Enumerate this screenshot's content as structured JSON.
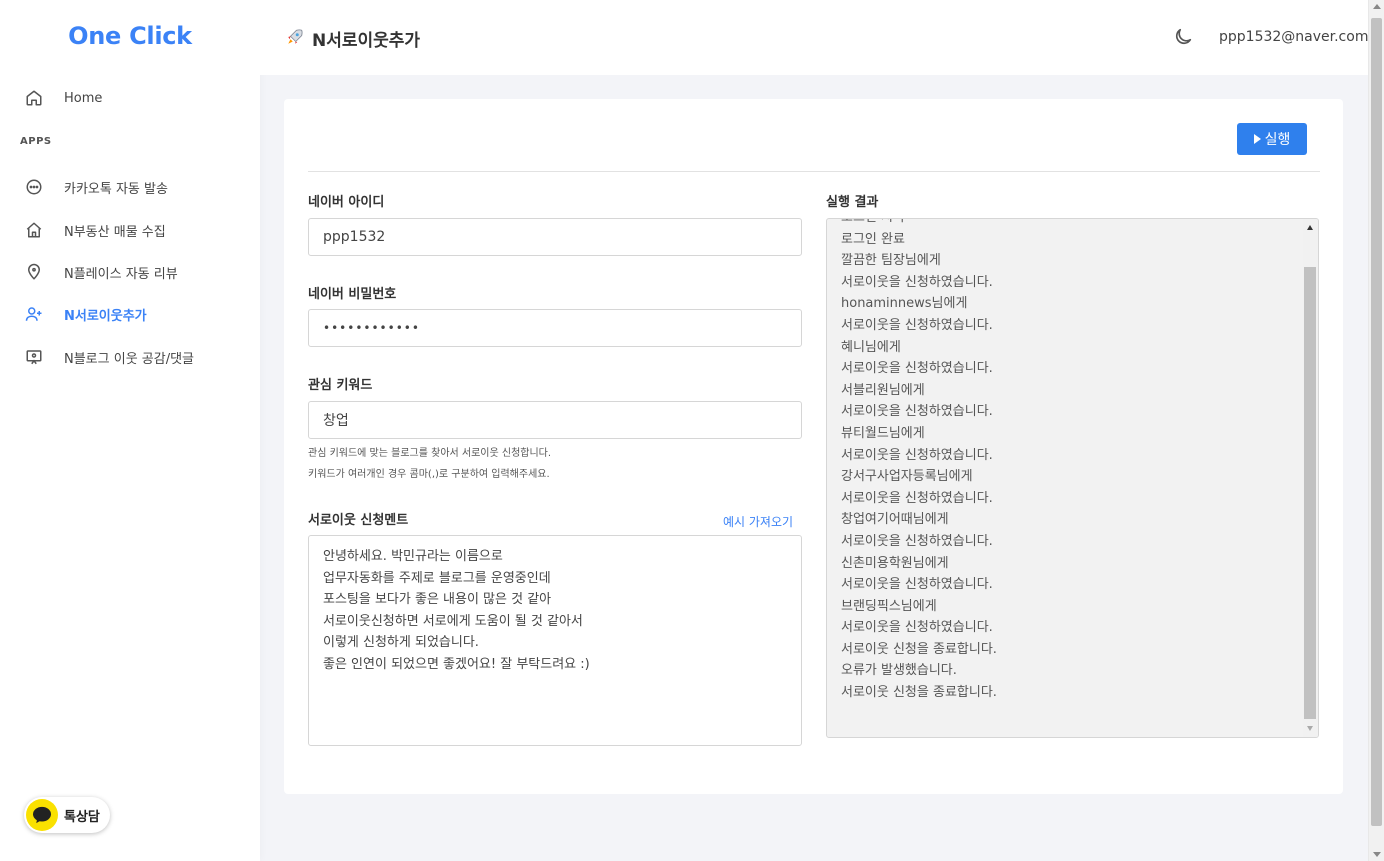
{
  "app": {
    "logo": "One Click",
    "accent_color": "#3b82f6"
  },
  "sidebar": {
    "section_label": "APPS",
    "items": [
      {
        "label": "Home",
        "icon": "home-icon"
      },
      {
        "label": "카카오톡 자동 발송",
        "icon": "chat-icon"
      },
      {
        "label": "N부동산 매물 수집",
        "icon": "house-icon"
      },
      {
        "label": "N플레이스 자동 리뷰",
        "icon": "map-pin-icon"
      },
      {
        "label": "N서로이웃추가",
        "icon": "user-plus-icon",
        "active": true
      },
      {
        "label": "N블로그 이웃 공감/댓글",
        "icon": "message-square-icon"
      }
    ],
    "kakao_label": "톡상담"
  },
  "header": {
    "title": "N서로이웃추가",
    "title_icon": "rocket-icon",
    "theme_icon": "moon-icon",
    "user_email": "ppp1532@naver.com"
  },
  "form": {
    "run_label": "실행",
    "id_label": "네이버 아이디",
    "id_value": "ppp1532",
    "pw_label": "네이버 비밀번호",
    "pw_value": "••••••••••••",
    "keyword_label": "관심 키워드",
    "keyword_value": "창업",
    "keyword_help_1": "관심 키워드에 맞는 블로그를 찾아서 서로이웃 신청합니다.",
    "keyword_help_2": "키워드가 여러개인 경우 콤마(,)로 구분하여 입력해주세요.",
    "message_label": "서로이웃 신청멘트",
    "example_link": "예시 가져오기",
    "message_lines": [
      "안녕하세요. 박민규라는 이름으로",
      "업무자동화를 주제로 블로그를 운영중인데",
      "포스팅을 보다가 좋은 내용이 많은 것 같아",
      "서로이웃신청하면 서로에게 도움이 될 것 같아서",
      "이렇게 신청하게 되었습니다.",
      "좋은 인연이 되었으면 좋겠어요! 잘 부탁드려요 :)"
    ]
  },
  "result": {
    "label": "실행 결과",
    "lines": [
      "로그인 시작",
      "로그인 완료",
      "깔끔한 팀장님에게",
      "서로이웃을 신청하였습니다.",
      "honaminnews님에게",
      "서로이웃을 신청하였습니다.",
      "혜니님에게",
      "서로이웃을 신청하였습니다.",
      "서블리원님에게",
      "서로이웃을 신청하였습니다.",
      "뷰티월드님에게",
      "서로이웃을 신청하였습니다.",
      "강서구사업자등록님에게",
      "서로이웃을 신청하였습니다.",
      "창업여기어때님에게",
      "서로이웃을 신청하였습니다.",
      "신촌미용학원님에게",
      "서로이웃을 신청하였습니다.",
      "브랜딩픽스님에게",
      "서로이웃을 신청하였습니다.",
      "서로이웃 신청을 종료합니다.",
      "오류가 발생했습니다.",
      "서로이웃 신청을 종료합니다."
    ]
  }
}
